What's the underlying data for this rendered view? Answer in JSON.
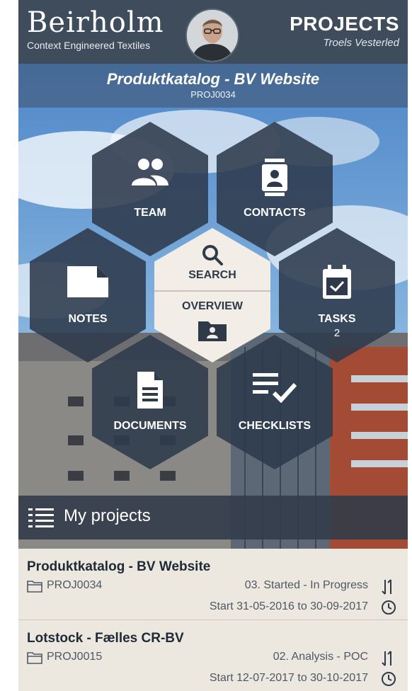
{
  "header": {
    "brand_name": "Beirholm",
    "brand_tagline": "Context Engineered Textiles",
    "section_title": "PROJECTS",
    "user_name": "Troels Vesterled"
  },
  "project": {
    "title": "Produktkatalog - BV Website",
    "id": "PROJ0034"
  },
  "menu": {
    "team": "TEAM",
    "contacts": "CONTACTS",
    "notes": "NOTES",
    "search": "SEARCH",
    "overview": "OVERVIEW",
    "tasks": "TASKS",
    "tasks_count": "2",
    "documents": "DOCUMENTS",
    "checklists": "CHECKLISTS"
  },
  "projects_bar": {
    "label": "My projects"
  },
  "projects": [
    {
      "name": "Produktkatalog - BV Website",
      "id": "PROJ0034",
      "status": "03. Started - In Progress",
      "dates": "Start 31-05-2016 to 30-09-2017"
    },
    {
      "name": "Lotstock - Fælles CR-BV",
      "id": "PROJ0015",
      "status": "02. Analysis - POC",
      "dates": "Start 12-07-2017 to 30-10-2017"
    }
  ],
  "icons": {
    "team": "people-icon",
    "contacts": "contact-card-icon",
    "notes": "note-icon",
    "search": "search-icon",
    "overview": "folder-user-icon",
    "tasks": "calendar-check-icon",
    "documents": "document-icon",
    "checklists": "checklist-icon",
    "menu": "list-menu-icon",
    "folder": "folder-icon",
    "sort": "sort-icon",
    "clock": "clock-icon"
  },
  "colors": {
    "header_bg": "#3f4c5c",
    "hex_bg": "#2e3a4c",
    "center_bg": "#f2ede6",
    "list_bg": "#ece7df"
  }
}
